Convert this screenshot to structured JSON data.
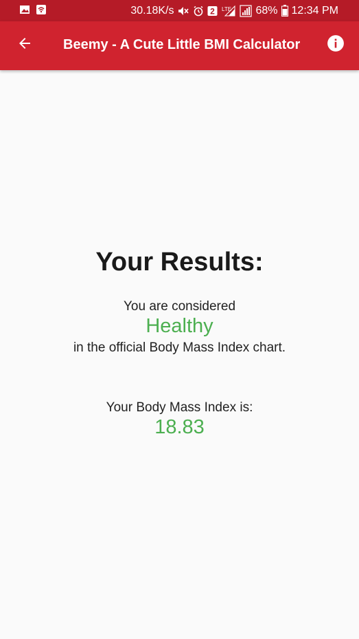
{
  "status_bar": {
    "speed": "30.18K/s",
    "notification_count": "2",
    "network": "LTE",
    "battery": "68%",
    "time": "12:34 PM"
  },
  "app_bar": {
    "title": "Beemy - A Cute Little BMI Calculator",
    "back_icon": "arrow-back-icon",
    "info_icon": "info-icon"
  },
  "results": {
    "heading": "Your Results:",
    "considered_prefix": "You are considered",
    "category": "Healthy",
    "considered_suffix": "in the official Body Mass Index chart.",
    "bmi_label": "Your Body Mass Index is:",
    "bmi_value": "18.83"
  },
  "colors": {
    "status_bar": "#b51b27",
    "app_bar": "#d0232f",
    "accent_green": "#4caf50",
    "background": "#fafafa"
  }
}
